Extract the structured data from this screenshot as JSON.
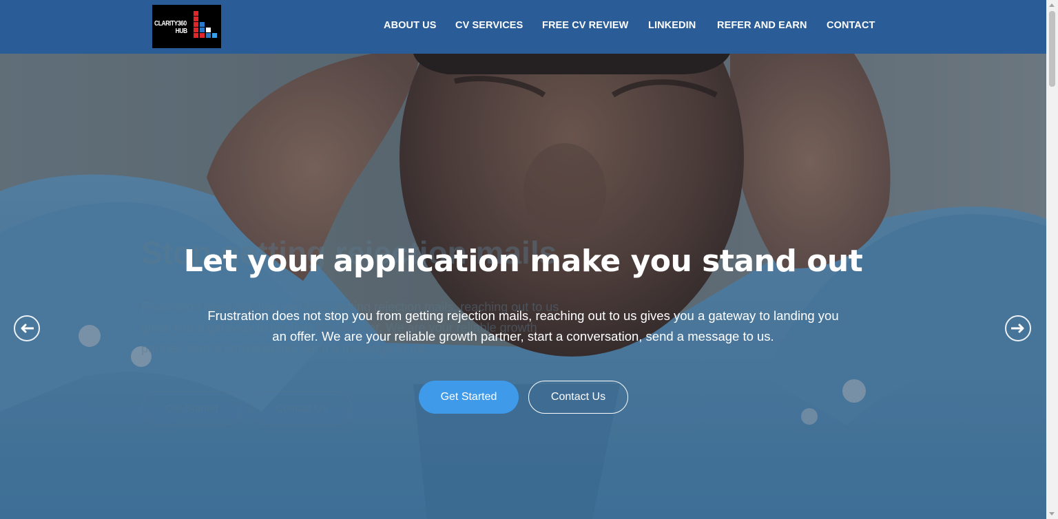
{
  "logo": {
    "line1": "CLARITY360",
    "line2": "HUB",
    "block_colors": [
      "#e3262b",
      "#2a78c9",
      "#ffffff",
      "#35a0e8"
    ]
  },
  "nav": {
    "items": [
      {
        "label": "ABOUT US"
      },
      {
        "label": "CV SERVICES"
      },
      {
        "label": "FREE CV REVIEW"
      },
      {
        "label": "LINKEDIN"
      },
      {
        "label": "REFER AND EARN"
      },
      {
        "label": "CONTACT"
      }
    ]
  },
  "hero": {
    "title": "Let your application make you stand out",
    "text": "Frustration does not stop you from getting rejection mails, reaching out to us gives you a gateway to landing you an offer. We are your reliable growth partner, start a conversation, send a message to us.",
    "primary_button": "Get Started",
    "secondary_button": "Contact Us",
    "prev_arrow": "🡐",
    "next_arrow": "🡒"
  },
  "ghost_slide": {
    "title": "Stop getting rejection mails",
    "text": "Frustration does not stop you from getting rejection mails, reaching out to us gives you a gateway to landing you an offer. We are your reliable growth partner, start a conversation, send a message to us.",
    "primary_button": "Get Started",
    "secondary_button": "Contact Us"
  },
  "colors": {
    "header_bg": "#2a5d98",
    "primary_button": "#3f9bea",
    "shirt_blue": "#4f90c4"
  }
}
